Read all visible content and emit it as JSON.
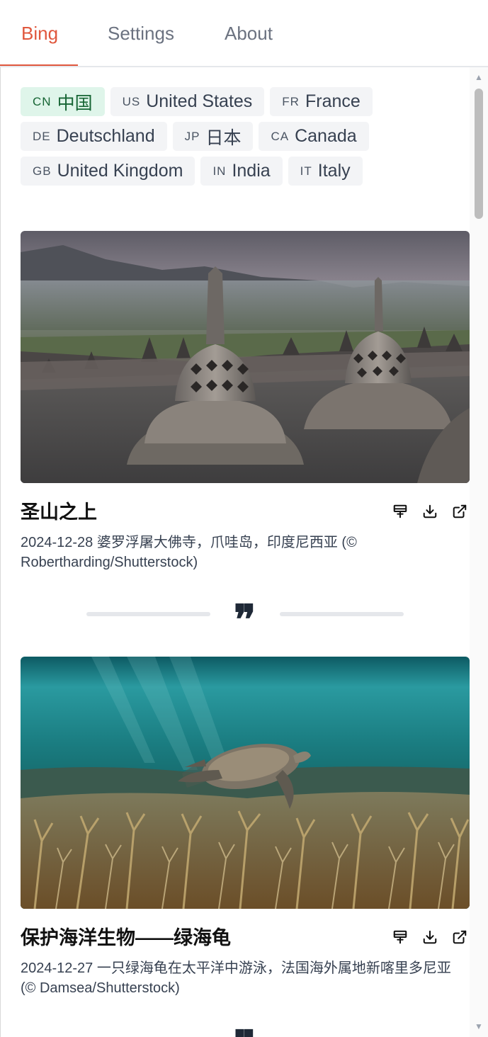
{
  "tabs": [
    {
      "label": "Bing"
    },
    {
      "label": "Settings"
    },
    {
      "label": "About"
    }
  ],
  "regions": [
    {
      "code": "CN",
      "name": "中国",
      "active": true
    },
    {
      "code": "US",
      "name": "United States"
    },
    {
      "code": "FR",
      "name": "France"
    },
    {
      "code": "DE",
      "name": "Deutschland"
    },
    {
      "code": "JP",
      "name": "日本"
    },
    {
      "code": "CA",
      "name": "Canada"
    },
    {
      "code": "GB",
      "name": "United Kingdom"
    },
    {
      "code": "IN",
      "name": "India"
    },
    {
      "code": "IT",
      "name": "Italy"
    }
  ],
  "cards": [
    {
      "title": "圣山之上",
      "desc": "2024-12-28 婆罗浮屠大佛寺，爪哇岛，印度尼西亚 (© Robertharding/Shutterstock)",
      "image": "borobudur-temple-photo"
    },
    {
      "title": "保护海洋生物——绿海龟",
      "desc": "2024-12-27 一只绿海龟在太平洋中游泳，法国海外属地新喀里多尼亚 (© Damsea/Shutterstock)",
      "image": "green-sea-turtle-photo"
    }
  ],
  "divider_icon": "quote-icon",
  "actions": [
    "set-wallpaper-icon",
    "download-icon",
    "open-external-icon"
  ],
  "colors": {
    "accent": "#e0573d",
    "active_chip_bg": "#dff5ea",
    "active_chip_text": "#166534"
  }
}
